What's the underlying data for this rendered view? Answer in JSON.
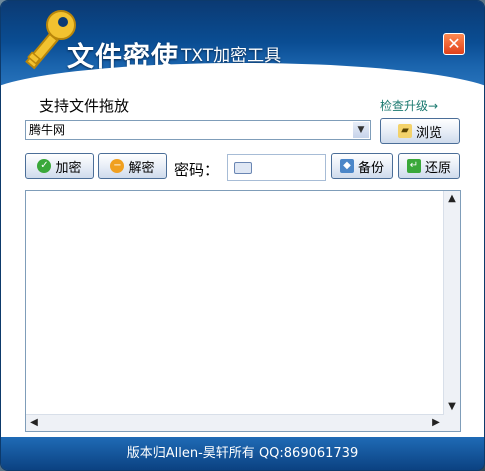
{
  "app": {
    "title": "文件密使",
    "subtitle": "TXT加密工具",
    "close_label": "✕"
  },
  "toolbar": {
    "drag_label": "支持文件拖放",
    "update_link": "检查升级→",
    "file_value": "腾牛网",
    "browse_label": "浏览",
    "encrypt_label": "加密",
    "decrypt_label": "解密",
    "password_label": "密码：",
    "password_value": "",
    "backup_label": "备份",
    "restore_label": "还原"
  },
  "editor": {
    "text": ""
  },
  "footer": {
    "text": "版本归Allen-昊轩所有  QQ:869061739"
  },
  "colors": {
    "title_bar": "#0a4d93",
    "footer": "#1f6bb6",
    "link": "#1b7a70"
  }
}
